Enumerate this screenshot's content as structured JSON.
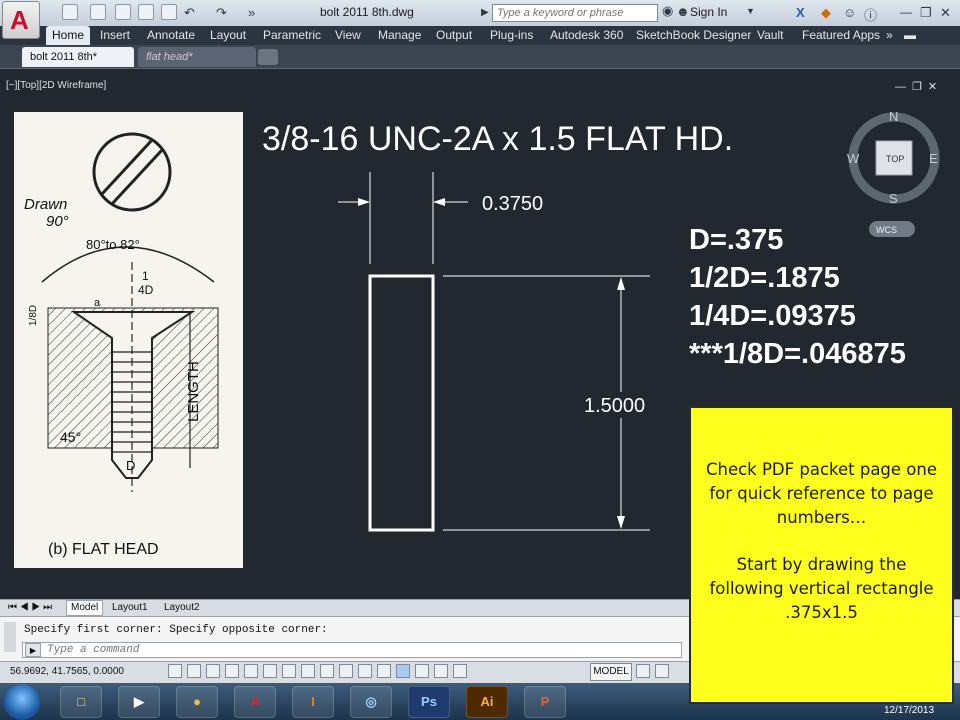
{
  "app": {
    "document_title": "bolt 2011 8th.dwg",
    "search_placeholder": "Type a keyword or phrase",
    "sign_in_label": "Sign In"
  },
  "ribbon": {
    "tabs": [
      "Home",
      "Insert",
      "Annotate",
      "Layout",
      "Parametric",
      "View",
      "Manage",
      "Output",
      "Plug-ins",
      "Autodesk 360",
      "SketchBook Designer",
      "Vault",
      "Featured Apps"
    ],
    "active_tab": "Home"
  },
  "document_tabs": {
    "active": "bolt 2011 8th*",
    "second": "flat head*"
  },
  "viewport": {
    "label": "[−][Top][2D Wireframe]"
  },
  "viewcube": {
    "north": "N",
    "south": "S",
    "east": "E",
    "west": "W",
    "face": "TOP",
    "wcs": "WCS"
  },
  "drawing": {
    "title": "3/8-16 UNC-2A x 1.5 FLAT HD.",
    "dim_width": "0.3750",
    "dim_length": "1.5000",
    "notes": [
      "D=.375",
      "1/2D=.1875",
      "1/4D=.09375",
      "***1/8D=.046875"
    ]
  },
  "reference_image": {
    "drawn": "Drawn",
    "drawn_angle": "90°",
    "head_angle": "80°to 82°",
    "quarter_d_top": "1",
    "quarter_d_bottom": "4D",
    "small_a": "a",
    "one_eighth": "1/8D",
    "chamfer": "45°",
    "length": "LENGTH",
    "dia": "D",
    "caption": "(b) FLAT HEAD"
  },
  "layout_tabs": [
    "Model",
    "Layout1",
    "Layout2"
  ],
  "command_line": {
    "history": "Specify first corner: Specify opposite corner:",
    "placeholder": "Type a command"
  },
  "status_bar": {
    "coordinates": "56.9692, 41.7565, 0.0000",
    "model_label": "MODEL"
  },
  "taskbar": {
    "clock_date": "12/17/2013",
    "ps_label": "Ps",
    "ai_label": "Ai"
  },
  "note": {
    "paragraph1": "Check PDF packet page one for quick reference to page numbers…",
    "paragraph2": "Start by drawing the following vertical rectangle .375x1.5"
  }
}
